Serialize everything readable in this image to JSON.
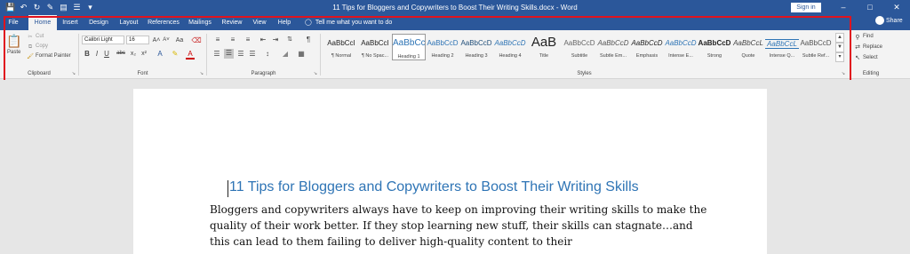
{
  "qat": {
    "save_icon": "save-icon",
    "undo_icon": "undo-icon",
    "redo_icon": "redo-icon",
    "customize_icon": "chevron-down-icon"
  },
  "window": {
    "title": "11 Tips for Bloggers and Copywriters to Boost Their Writing Skills.docx - Word",
    "sign_in": "Sign in",
    "minimize": "–",
    "restore": "□",
    "close": "✕"
  },
  "tabs": [
    {
      "label": "File"
    },
    {
      "label": "Home"
    },
    {
      "label": "Insert"
    },
    {
      "label": "Design"
    },
    {
      "label": "Layout"
    },
    {
      "label": "References"
    },
    {
      "label": "Mailings"
    },
    {
      "label": "Review"
    },
    {
      "label": "View"
    },
    {
      "label": "Help"
    }
  ],
  "tellme": {
    "text": "Tell me what you want to do"
  },
  "share": {
    "label": "Share"
  },
  "clipboard": {
    "paste": "Paste",
    "cut": "Cut",
    "copy": "Copy",
    "format_painter": "Format Painter",
    "label": "Clipboard"
  },
  "font": {
    "name": "Calibri Light",
    "size": "16",
    "grow": "A˄",
    "shrink": "A˅",
    "case": "Aa",
    "bold": "B",
    "italic": "I",
    "underline": "U",
    "strike": "abc",
    "sub": "x₂",
    "sup": "x²",
    "label": "Font"
  },
  "paragraph": {
    "label": "Paragraph",
    "pilcrow": "¶"
  },
  "styles": {
    "label": "Styles",
    "items": [
      {
        "sample": "AaBbCcI",
        "name": "¶ Normal"
      },
      {
        "sample": "AaBbCcI",
        "name": "¶ No Spac..."
      },
      {
        "sample": "AaBbCc",
        "name": "Heading 1"
      },
      {
        "sample": "AaBbCcD",
        "name": "Heading 2"
      },
      {
        "sample": "AaBbCcD",
        "name": "Heading 3"
      },
      {
        "sample": "AaBbCcD",
        "name": "Heading 4"
      },
      {
        "sample": "AaB",
        "name": "Title"
      },
      {
        "sample": "AaBbCcD",
        "name": "Subtitle"
      },
      {
        "sample": "AaBbCcD",
        "name": "Subtle Em..."
      },
      {
        "sample": "AaBbCcD",
        "name": "Emphasis"
      },
      {
        "sample": "AaBbCcD",
        "name": "Intense E..."
      },
      {
        "sample": "AaBbCcD",
        "name": "Strong"
      },
      {
        "sample": "AaBbCcL",
        "name": "Quote"
      },
      {
        "sample": "AaBbCcL",
        "name": "Intense Q..."
      },
      {
        "sample": "AaBbCcD",
        "name": "Subtle Ref..."
      }
    ]
  },
  "editing": {
    "find": "Find",
    "replace": "Replace",
    "select": "Select",
    "label": "Editing"
  },
  "document": {
    "heading": "11 Tips for Bloggers and Copywriters to Boost Their Writing Skills",
    "paragraph": "Bloggers and copywriters always have to keep on improving their writing skills to make the quality of their work better. If they stop learning new stuff, their skills can stagnate…and this can lead to them failing to deliver high-quality content to their"
  },
  "colors": {
    "brand": "#2b579a",
    "highlight": "#e0131e",
    "heading": "#2e74b5"
  }
}
